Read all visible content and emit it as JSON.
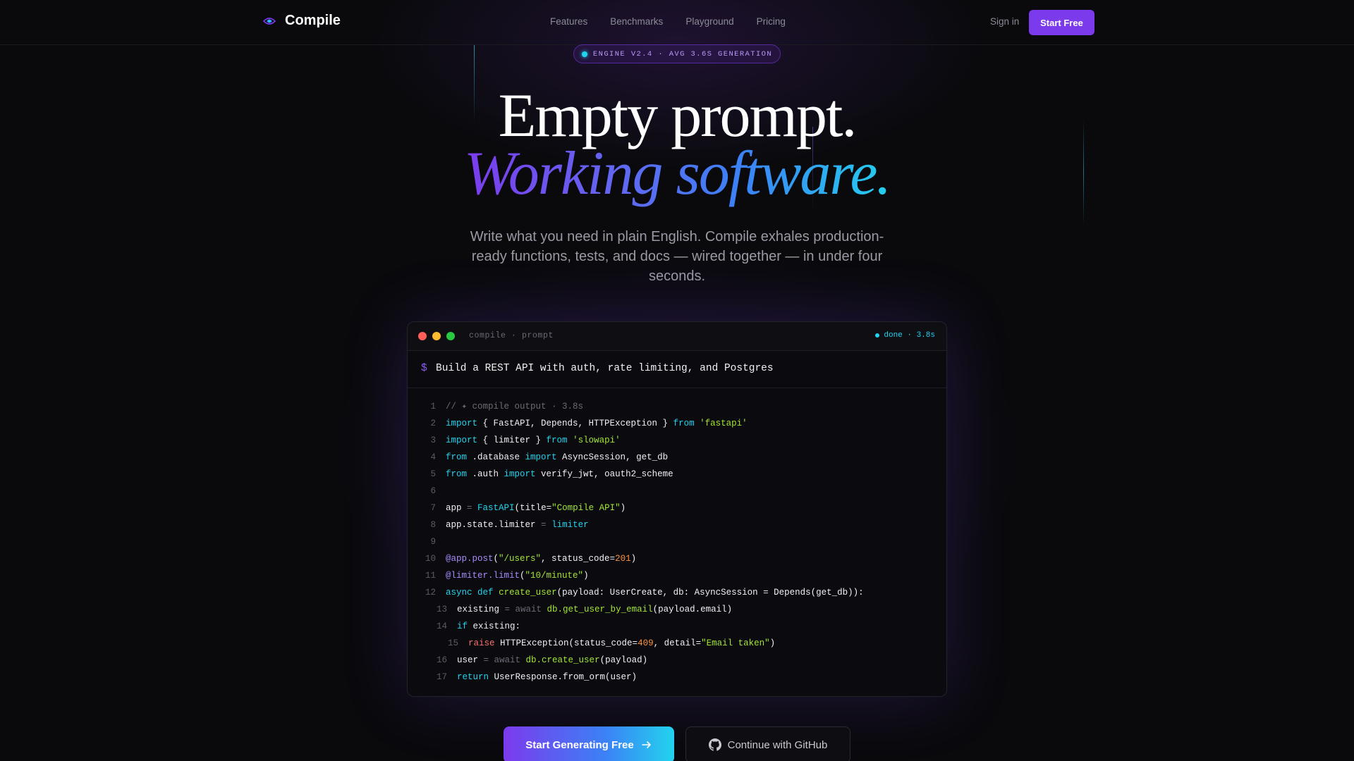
{
  "nav": {
    "brand": "Compile",
    "links": [
      "Features",
      "Benchmarks",
      "Playground",
      "Pricing"
    ],
    "sign_in": "Sign in",
    "start_free": "Start Free"
  },
  "badge": {
    "text": "ENGINE V2.4 · AVG 3.6S GENERATION"
  },
  "hero": {
    "line1": "Empty prompt.",
    "line2": "Working software.",
    "subtitle": "Write what you need in plain English. Compile exhales production-ready functions, tests, and docs — wired together — in under four seconds."
  },
  "terminal": {
    "title": "compile · prompt",
    "status": "done · 3.8s",
    "prompt_symbol": "$",
    "prompt": "Build a REST API with auth, rate limiting, and Postgres",
    "lines": [
      {
        "n": "1",
        "indent": 0,
        "tokens": [
          {
            "t": "// ✦ compile output · 3.8s",
            "c": "cm"
          }
        ]
      },
      {
        "n": "2",
        "indent": 0,
        "tokens": [
          {
            "t": "import",
            "c": "kw"
          },
          {
            "t": " { FastAPI, Depends, HTTPException } ",
            "c": "plain"
          },
          {
            "t": "from",
            "c": "kw"
          },
          {
            "t": " 'fastapi'",
            "c": "str"
          }
        ]
      },
      {
        "n": "3",
        "indent": 0,
        "tokens": [
          {
            "t": "import",
            "c": "kw"
          },
          {
            "t": " { limiter } ",
            "c": "plain"
          },
          {
            "t": "from",
            "c": "kw"
          },
          {
            "t": " 'slowapi'",
            "c": "str"
          }
        ]
      },
      {
        "n": "4",
        "indent": 0,
        "tokens": [
          {
            "t": "from",
            "c": "kw"
          },
          {
            "t": " .database ",
            "c": "plain"
          },
          {
            "t": "import",
            "c": "kw"
          },
          {
            "t": " AsyncSession, get_db",
            "c": "plain"
          }
        ]
      },
      {
        "n": "5",
        "indent": 0,
        "tokens": [
          {
            "t": "from",
            "c": "kw"
          },
          {
            "t": " .auth ",
            "c": "plain"
          },
          {
            "t": "import",
            "c": "kw"
          },
          {
            "t": " verify_jwt, oauth2_scheme",
            "c": "plain"
          }
        ]
      },
      {
        "n": "6",
        "indent": 0,
        "tokens": []
      },
      {
        "n": "7",
        "indent": 0,
        "tokens": [
          {
            "t": "app ",
            "c": "plain"
          },
          {
            "t": "=",
            "c": "op"
          },
          {
            "t": " ",
            "c": "plain"
          },
          {
            "t": "FastAPI",
            "c": "cls"
          },
          {
            "t": "(title=",
            "c": "plain"
          },
          {
            "t": "\"Compile API\"",
            "c": "str"
          },
          {
            "t": ")",
            "c": "plain"
          }
        ]
      },
      {
        "n": "8",
        "indent": 0,
        "tokens": [
          {
            "t": "app.state.limiter ",
            "c": "plain"
          },
          {
            "t": "=",
            "c": "op"
          },
          {
            "t": " ",
            "c": "plain"
          },
          {
            "t": "limiter",
            "c": "cls"
          }
        ]
      },
      {
        "n": "9",
        "indent": 0,
        "tokens": []
      },
      {
        "n": "10",
        "indent": 0,
        "tokens": [
          {
            "t": "@app.post",
            "c": "dec"
          },
          {
            "t": "(",
            "c": "plain"
          },
          {
            "t": "\"/users\"",
            "c": "str"
          },
          {
            "t": ", status_code=",
            "c": "plain"
          },
          {
            "t": "201",
            "c": "num"
          },
          {
            "t": ")",
            "c": "plain"
          }
        ]
      },
      {
        "n": "11",
        "indent": 0,
        "tokens": [
          {
            "t": "@limiter.limit",
            "c": "dec"
          },
          {
            "t": "(",
            "c": "plain"
          },
          {
            "t": "\"10/minute\"",
            "c": "str"
          },
          {
            "t": ")",
            "c": "plain"
          }
        ]
      },
      {
        "n": "12",
        "indent": 0,
        "tokens": [
          {
            "t": "async",
            "c": "kw"
          },
          {
            "t": " ",
            "c": "plain"
          },
          {
            "t": "def",
            "c": "kw"
          },
          {
            "t": " ",
            "c": "plain"
          },
          {
            "t": "create_user",
            "c": "fn"
          },
          {
            "t": "(payload: UserCreate, db: AsyncSession = Depends(get_db)):",
            "c": "plain"
          }
        ]
      },
      {
        "n": "13",
        "indent": 1,
        "tokens": [
          {
            "t": "existing ",
            "c": "plain"
          },
          {
            "t": "= await",
            "c": "op"
          },
          {
            "t": " ",
            "c": "plain"
          },
          {
            "t": "db.get_user_by_email",
            "c": "fn"
          },
          {
            "t": "(payload.email)",
            "c": "plain"
          }
        ]
      },
      {
        "n": "14",
        "indent": 1,
        "tokens": [
          {
            "t": "if",
            "c": "kw"
          },
          {
            "t": " existing:",
            "c": "plain"
          }
        ]
      },
      {
        "n": "15",
        "indent": 2,
        "tokens": [
          {
            "t": "raise",
            "c": "raise"
          },
          {
            "t": " HTTPException(status_code=",
            "c": "plain"
          },
          {
            "t": "409",
            "c": "num"
          },
          {
            "t": ", detail=",
            "c": "plain"
          },
          {
            "t": "\"Email taken\"",
            "c": "str"
          },
          {
            "t": ")",
            "c": "plain"
          }
        ]
      },
      {
        "n": "16",
        "indent": 1,
        "tokens": [
          {
            "t": "user ",
            "c": "plain"
          },
          {
            "t": "= await",
            "c": "op"
          },
          {
            "t": " ",
            "c": "plain"
          },
          {
            "t": "db.create_user",
            "c": "fn"
          },
          {
            "t": "(payload)",
            "c": "plain"
          }
        ]
      },
      {
        "n": "17",
        "indent": 1,
        "tokens": [
          {
            "t": "return",
            "c": "kw"
          },
          {
            "t": " UserResponse.from_orm(user)",
            "c": "plain"
          }
        ]
      }
    ]
  },
  "cta": {
    "primary": "Start Generating Free",
    "secondary": "Continue with GitHub"
  },
  "icons": {
    "brand": "compile-logo-icon",
    "arrow": "arrow-right-icon",
    "github": "github-icon",
    "window_controls": [
      "close-dot",
      "minimize-dot",
      "maximize-dot"
    ]
  },
  "colors": {
    "accent": "#7c3aed",
    "cyan": "#22d3ee",
    "blue": "#3b82f6",
    "background": "#0a0a0d"
  }
}
